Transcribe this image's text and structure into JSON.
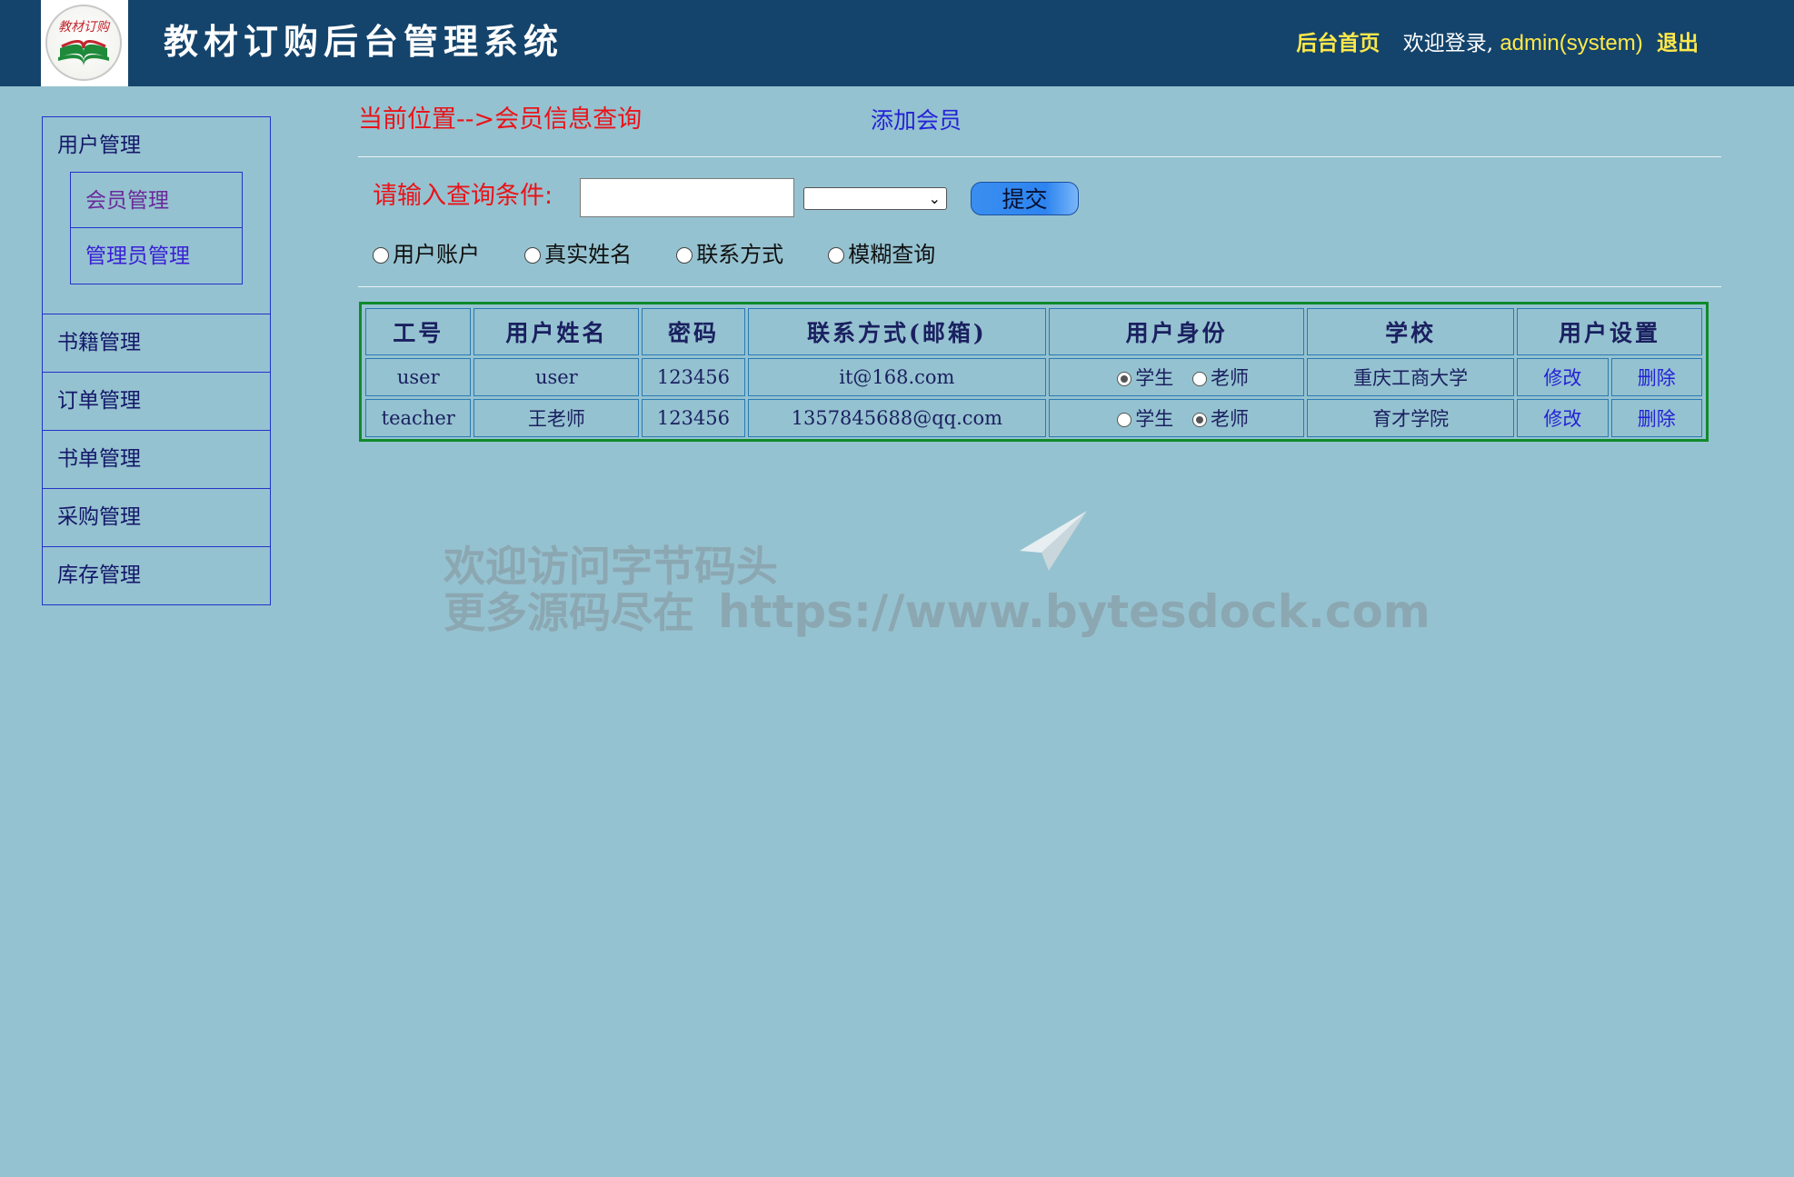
{
  "header": {
    "logo_text": "教材订购",
    "title": "教材订购后台管理系统",
    "home_link": "后台首页",
    "welcome": "欢迎登录,",
    "username": "admin(system)",
    "logout": "退出"
  },
  "sidebar": {
    "groups": [
      {
        "label": "用户管理",
        "items": [
          {
            "label": "会员管理"
          },
          {
            "label": "管理员管理"
          }
        ]
      },
      {
        "label": "书籍管理"
      },
      {
        "label": "订单管理"
      },
      {
        "label": "书单管理"
      },
      {
        "label": "采购管理"
      },
      {
        "label": "库存管理"
      }
    ]
  },
  "main": {
    "location": "当前位置-->会员信息查询",
    "add_member": "添加会员",
    "query_label": "请输入查询条件:",
    "query_value": "",
    "select_value": "",
    "submit": "提交",
    "radios": [
      "用户账户",
      "真实姓名",
      "联系方式",
      "模糊查询"
    ]
  },
  "table": {
    "headers": [
      "工号",
      "用户姓名",
      "密码",
      "联系方式(邮箱)",
      "用户身份",
      "学校",
      "用户设置"
    ],
    "role_student": "学生",
    "role_teacher": "老师",
    "edit": "修改",
    "delete": "删除",
    "rows": [
      {
        "id": "user",
        "name": "user",
        "password": "123456",
        "contact": "it@168.com",
        "role": "学生",
        "school": "重庆工商大学"
      },
      {
        "id": "teacher",
        "name": "王老师",
        "password": "123456",
        "contact": "1357845688@qq.com",
        "role": "老师",
        "school": "育才学院"
      }
    ]
  },
  "watermark": {
    "line1": "欢迎访问字节码头",
    "line2": "更多源码尽在",
    "url": "https://www.bytesdock.com"
  },
  "colors": {
    "header_bg": "#14446c",
    "page_bg": "#95c2d0",
    "accent_red": "#e8141a",
    "link_blue": "#2422d6",
    "table_border": "#0f8a2a"
  }
}
